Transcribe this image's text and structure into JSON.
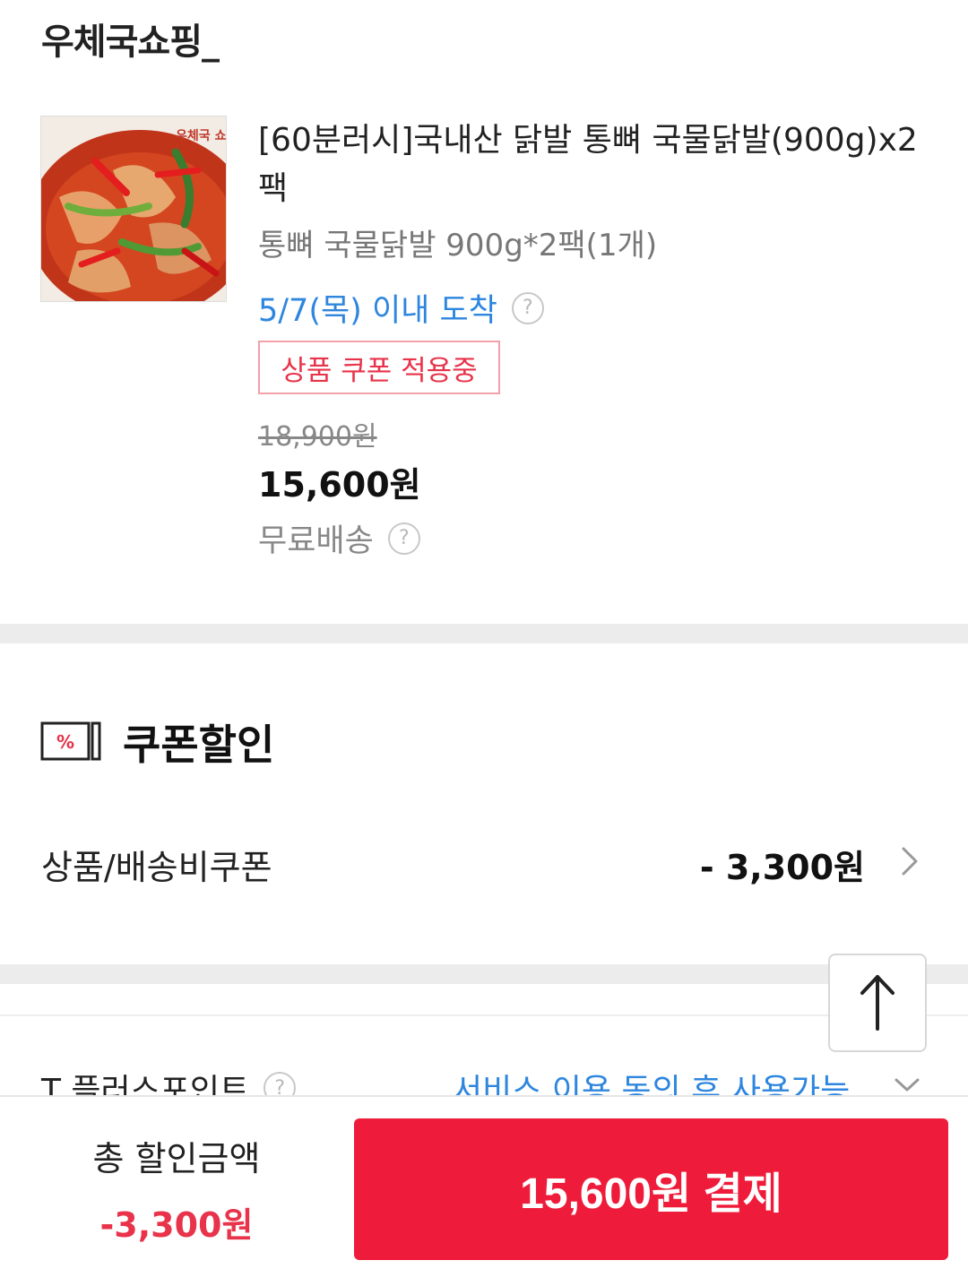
{
  "store": {
    "name": "우체국쇼핑_"
  },
  "product": {
    "thumbnail_brand": "우체국 쇼핑",
    "title": "[60분러시]국내산 닭발 통뼈 국물닭발(900g)x2팩",
    "option": "통뼈 국물닭발 900g*2팩(1개)",
    "delivery": "5/7(목) 이내 도착",
    "coupon_badge": "상품 쿠폰 적용중",
    "original_price": "18,900원",
    "sale_price": "15,600원",
    "shipping": "무료배송"
  },
  "coupon_section": {
    "heading": "쿠폰할인",
    "icon_text": "%",
    "row_label": "상품/배송비쿠폰",
    "row_value": "- 3,300원"
  },
  "tplus": {
    "label": "T 플러스포인트",
    "value": "서비스 이용 동의 후 사용가능"
  },
  "bottom_bar": {
    "total_label": "총 할인금액",
    "total_value": "-3,300원",
    "pay_button": "15,600원 결제"
  },
  "colors": {
    "accent_red": "#ee1c3a",
    "link_blue": "#2e86de",
    "badge_red": "#e8334a"
  },
  "icons": [
    "help-icon",
    "coupon-icon",
    "chevron-right-icon",
    "chevron-down-icon",
    "arrow-up-icon"
  ]
}
